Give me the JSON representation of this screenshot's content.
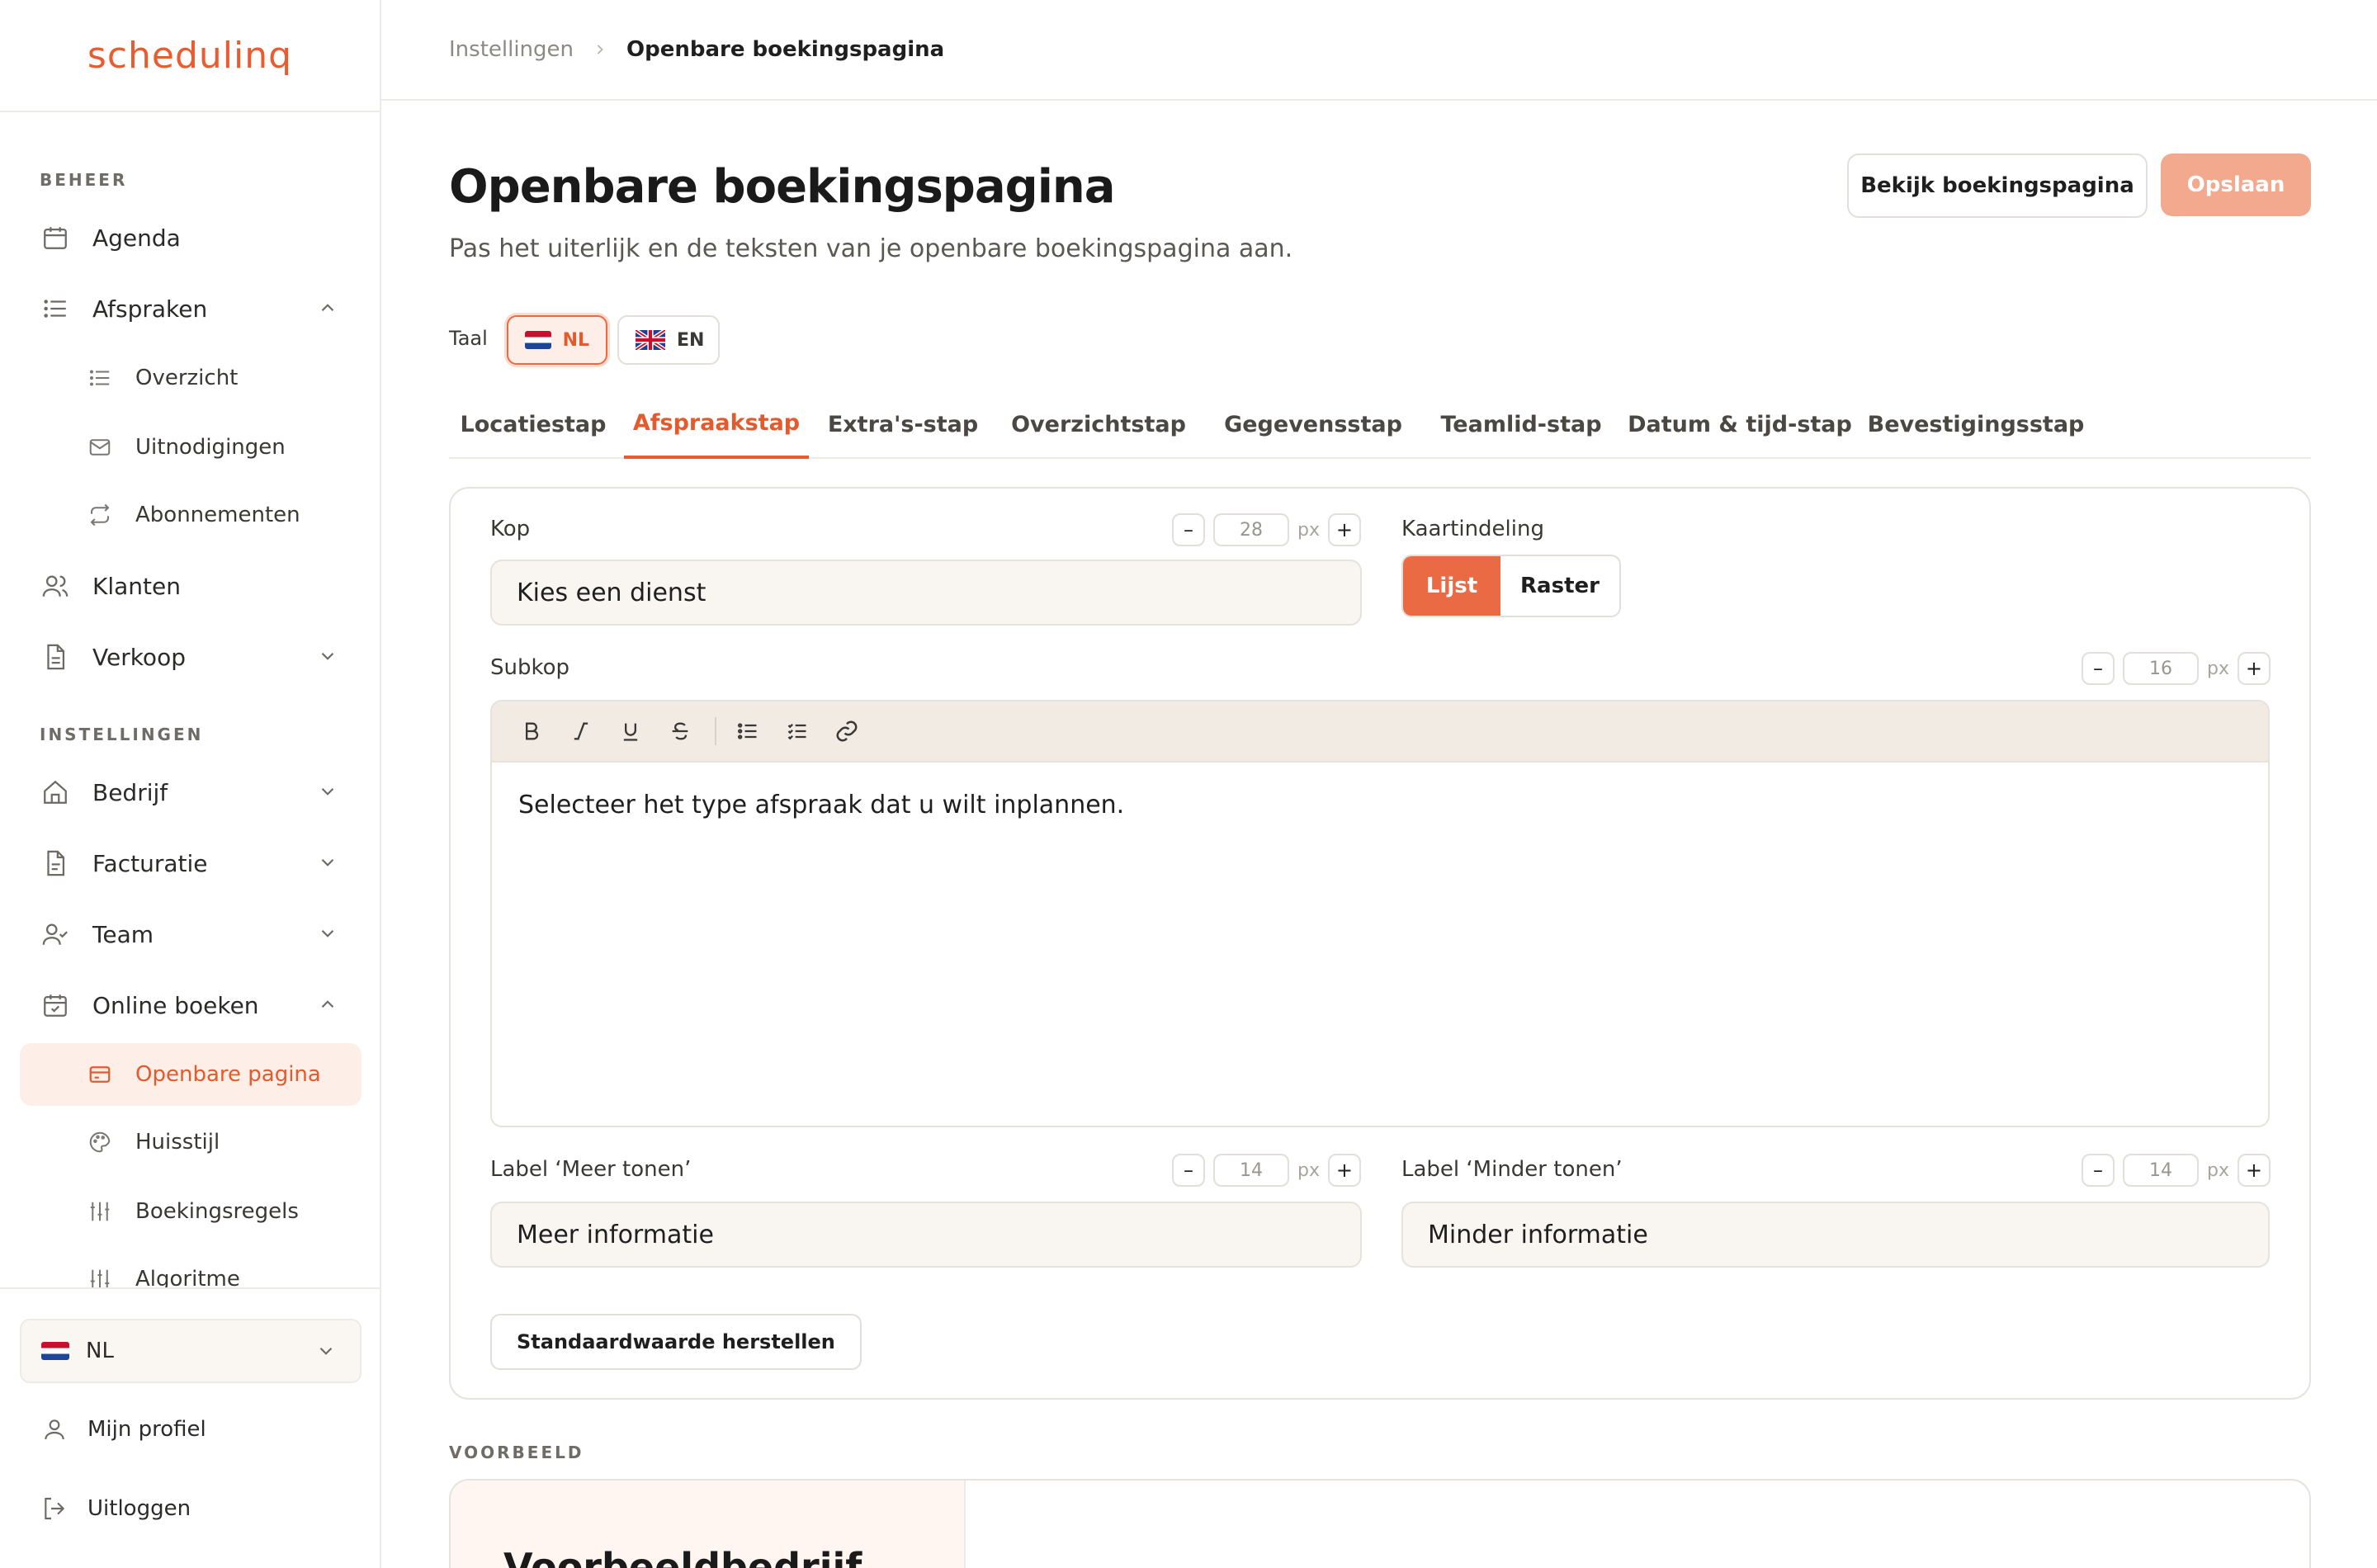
{
  "app": {
    "logo": "schedulinq"
  },
  "sidebar": {
    "section_beheer": "BEHEER",
    "section_instellingen": "INSTELLINGEN",
    "items": {
      "agenda": "Agenda",
      "afspraken": "Afspraken",
      "overzicht": "Overzicht",
      "uitnodigingen": "Uitnodigingen",
      "abonnementen": "Abonnementen",
      "klanten": "Klanten",
      "verkoop": "Verkoop",
      "bedrijf": "Bedrijf",
      "facturatie": "Facturatie",
      "team": "Team",
      "online_boeken": "Online boeken",
      "openbare_pagina": "Openbare pagina",
      "huisstijl": "Huisstijl",
      "boekingsregels": "Boekingsregels",
      "algoritme": "Algoritme"
    },
    "language": "NL",
    "profile": "Mijn profiel",
    "logout": "Uitloggen"
  },
  "breadcrumb": {
    "parent": "Instellingen",
    "current": "Openbare boekingspagina"
  },
  "page": {
    "title": "Openbare boekingspagina",
    "subtitle": "Pas het uiterlijk en de teksten van je openbare boekingspagina aan.",
    "view_button": "Bekijk boekingspagina",
    "save_button": "Opslaan",
    "lang_label": "Taal",
    "lang_nl": "NL",
    "lang_en": "EN"
  },
  "tabs": [
    "Locatiestap",
    "Afspraakstap",
    "Extra's-stap",
    "Overzichtstap",
    "Gegevensstap",
    "Teamlid-stap",
    "Datum & tijd-stap",
    "Bevestigingsstap"
  ],
  "form": {
    "kop_label": "Kop",
    "kop_value": "Kies een dienst",
    "kop_size": "28",
    "unit": "px",
    "kaart_label": "Kaartindeling",
    "kaart_lijst": "Lijst",
    "kaart_raster": "Raster",
    "subkop_label": "Subkop",
    "subkop_size": "16",
    "subkop_value": "Selecteer het type afspraak dat u wilt inplannen.",
    "meer_label": "Label ‘Meer tonen’",
    "meer_size": "14",
    "meer_value": "Meer informatie",
    "minder_label": "Label ‘Minder tonen’",
    "minder_size": "14",
    "minder_value": "Minder informatie",
    "reset_button": "Standaardwaarde herstellen",
    "minus": "–",
    "plus": "+"
  },
  "preview": {
    "label": "VOORBEELD",
    "company": "Voorbeeldbedrijf"
  },
  "colors": {
    "accent": "#ea5b2e",
    "accent_light": "#fdeee7",
    "save_disabled": "#f3a98e"
  }
}
